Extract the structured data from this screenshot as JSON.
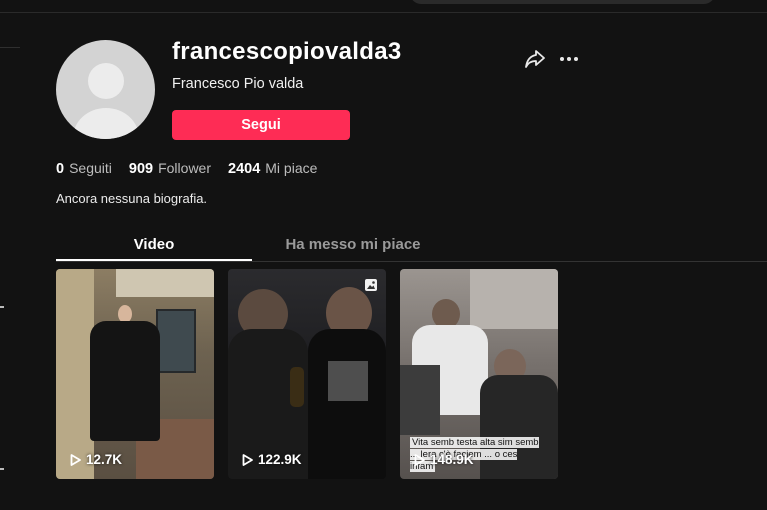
{
  "profile": {
    "username": "francescopiovalda3",
    "display_name": "Francesco Pio valda",
    "follow_label": "Segui",
    "bio": "Ancora nessuna biografia."
  },
  "stats": {
    "following": {
      "count": "0",
      "label": "Seguiti"
    },
    "followers": {
      "count": "909",
      "label": "Follower"
    },
    "likes": {
      "count": "2404",
      "label": "Mi piace"
    }
  },
  "tabs": [
    {
      "label": "Video",
      "active": true
    },
    {
      "label": "Ha messo mi piace",
      "active": false
    }
  ],
  "videos": [
    {
      "views": "12.7K"
    },
    {
      "views": "122.9K",
      "is_photo": true
    },
    {
      "views": "148.9K",
      "caption": "Vita semb testa alta sim semb ... lera c'è faciem ... o ces infam"
    }
  ],
  "icons": {
    "share": "share-icon",
    "more": "more-icon",
    "play": "play-icon",
    "photo": "photo-icon"
  },
  "colors": {
    "accent": "#fe2c55",
    "background": "#121212"
  }
}
